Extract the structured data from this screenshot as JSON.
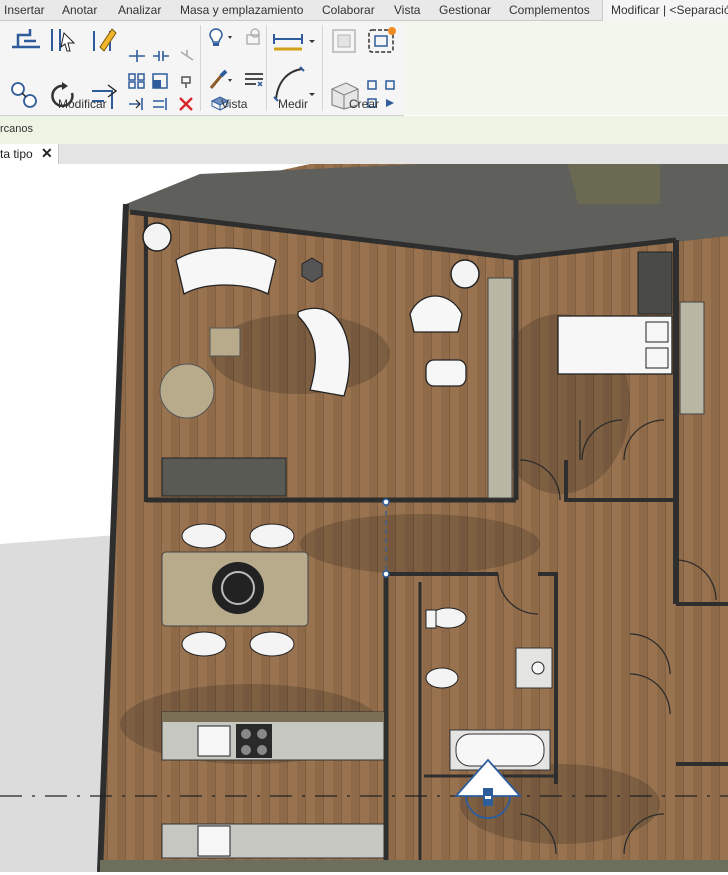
{
  "ribbon": {
    "tabs": [
      "Insertar",
      "Anotar",
      "Analizar",
      "Masa y emplazamiento",
      "Colaborar",
      "Vista",
      "Gestionar",
      "Complementos"
    ],
    "active_tab": "Modificar | <Separació",
    "groups": {
      "modificar": "Modificar",
      "vista": "Vista",
      "medir": "Medir",
      "crear": "Crear"
    }
  },
  "options_bar": {
    "text": "rcanos"
  },
  "view_tab": {
    "label": "ta tipo",
    "close": "✕"
  },
  "colors": {
    "floor": "#8f6a49",
    "wall": "#2e2e2e",
    "roof": "#5f5f5c",
    "ribbon_bg": "#f5f5f5",
    "options_bg": "#eef4e4",
    "accent_blue": "#2f5d9c"
  }
}
